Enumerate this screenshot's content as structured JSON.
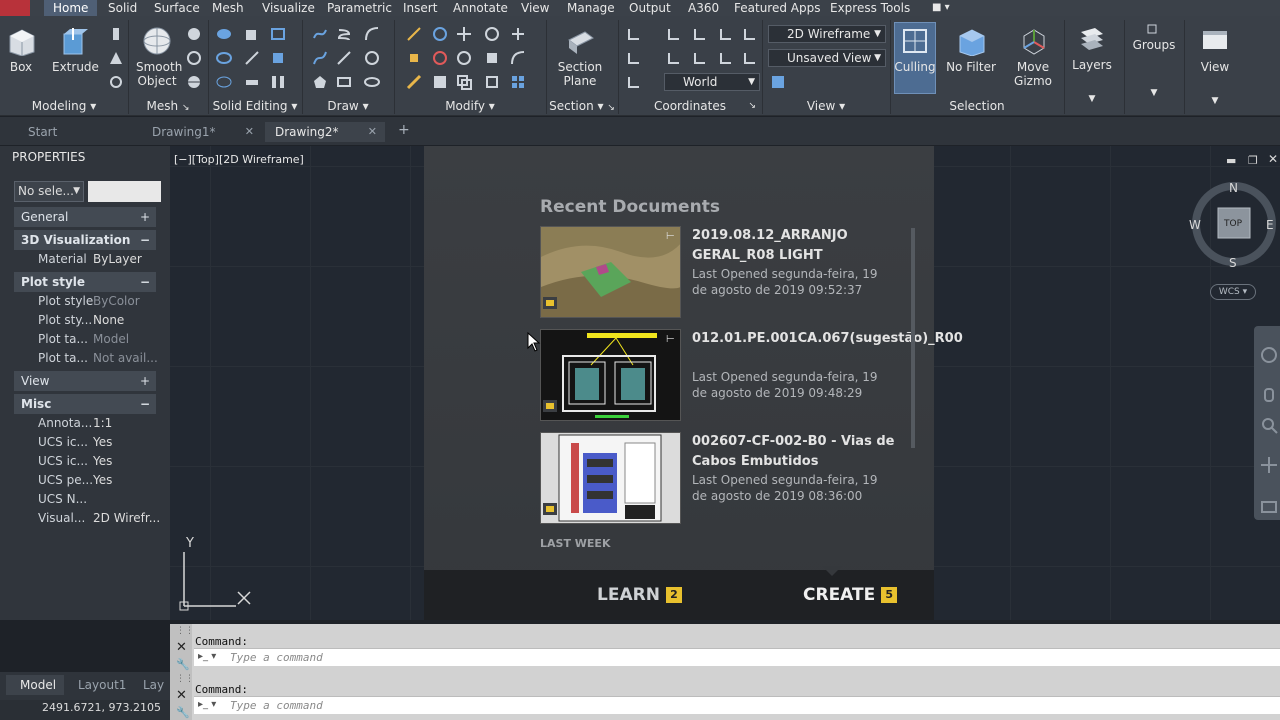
{
  "menu": {
    "tabs": [
      "Home",
      "Solid",
      "Surface",
      "Mesh",
      "Visualize",
      "Parametric",
      "Insert",
      "Annotate",
      "View",
      "Manage",
      "Output",
      "A360",
      "Featured Apps",
      "Express Tools"
    ]
  },
  "ribbon": {
    "big_buttons": {
      "box": "Box",
      "extrude": "Extrude",
      "smooth_object": "Smooth\nObject",
      "section_plane": "Section\nPlane",
      "culling": "Culling",
      "no_filter": "No Filter",
      "move_gizmo": "Move\nGizmo",
      "layers": "Layers",
      "groups": "Groups",
      "view": "View"
    },
    "panels": [
      "Modeling",
      "Mesh",
      "Solid Editing",
      "Draw",
      "Modify",
      "Section",
      "Coordinates",
      "View",
      "Selection"
    ],
    "visual_style": "2D Wireframe",
    "named_view": "Unsaved View",
    "ucs": "World"
  },
  "doc_tabs": [
    "Start",
    "Drawing1*",
    "Drawing2*"
  ],
  "properties": {
    "title": "PROPERTIES",
    "selection": "No sele...",
    "sections": {
      "general": "General",
      "viz": "3D Visualization",
      "plot": "Plot style",
      "view": "View",
      "misc": "Misc"
    },
    "rows": {
      "material_k": "Material",
      "material_v": "ByLayer",
      "ps_k": "Plot style",
      "ps_v": "ByColor",
      "pst_k": "Plot sty...",
      "pst_v": "None",
      "ptab_k": "Plot ta...",
      "ptab_v": "Model",
      "ptab2_k": "Plot ta...",
      "ptab2_v": "Not avail...",
      "anno_k": "Annota...",
      "anno_v": "1:1",
      "ucsi_k": "UCS ic...",
      "ucsi_v": "Yes",
      "ucsi2_k": "UCS ic...",
      "ucsi2_v": "Yes",
      "ucsp_k": "UCS pe...",
      "ucsp_v": "Yes",
      "ucsn_k": "UCS N...",
      "ucsn_v": "",
      "vis_k": "Visual...",
      "vis_v": "2D Wirefr..."
    }
  },
  "viewport": {
    "label": "[−][Top][2D Wireframe]",
    "cube": {
      "n": "N",
      "s": "S",
      "e": "E",
      "w": "W",
      "top": "TOP",
      "wcs": "WCS"
    },
    "ucs_y": "Y"
  },
  "start": {
    "recent_title": "Recent Documents",
    "docs": [
      {
        "name": "2019.08.12_ARRANJO GERAL_R08 LIGHT",
        "meta": "Last Opened segunda-feira, 19 de agosto de 2019 09:52:37"
      },
      {
        "name": "012.01.PE.001CA.067(sugestão)_R00",
        "meta": "Last Opened segunda-feira, 19 de agosto de 2019 09:48:29"
      },
      {
        "name": "002607-CF-002-B0 - Vias de Cabos Embutidos",
        "meta": "Last Opened segunda-feira, 19 de agosto de 2019 08:36:00"
      }
    ],
    "last_week": "LAST WEEK",
    "learn": "LEARN",
    "learn_count": "2",
    "create": "CREATE",
    "create_count": "5"
  },
  "command": {
    "label": "Command:",
    "placeholder": "Type a command"
  },
  "layout_tabs": [
    "Model",
    "Layout1",
    "Lay"
  ],
  "coords": "2491.6721, 973.2105"
}
